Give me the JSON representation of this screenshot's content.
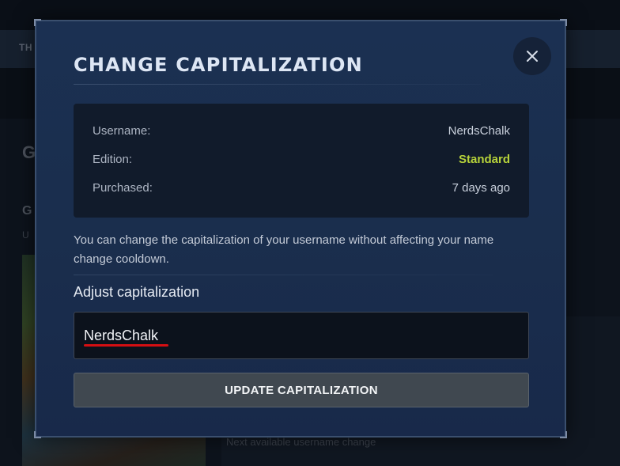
{
  "background": {
    "nav_text": "TH",
    "heading_1": "G",
    "heading_2": "G",
    "sub_text": "U",
    "next_change_text": "Next available username change"
  },
  "modal": {
    "title": "CHANGE CAPITALIZATION",
    "close_icon": "close-icon",
    "info": {
      "username_label": "Username:",
      "username_value": "NerdsChalk",
      "edition_label": "Edition:",
      "edition_value": "Standard",
      "purchased_label": "Purchased:",
      "purchased_value": "7 days ago"
    },
    "description": "You can change the capitalization of your username without affecting your name change cooldown.",
    "adjust_label": "Adjust capitalization",
    "input_value": "NerdsChalk",
    "update_button": "UPDATE CAPITALIZATION"
  },
  "colors": {
    "accent_green": "#b7d33a",
    "annotation_red": "#d40f12",
    "modal_bg": "#1a2e4d"
  }
}
